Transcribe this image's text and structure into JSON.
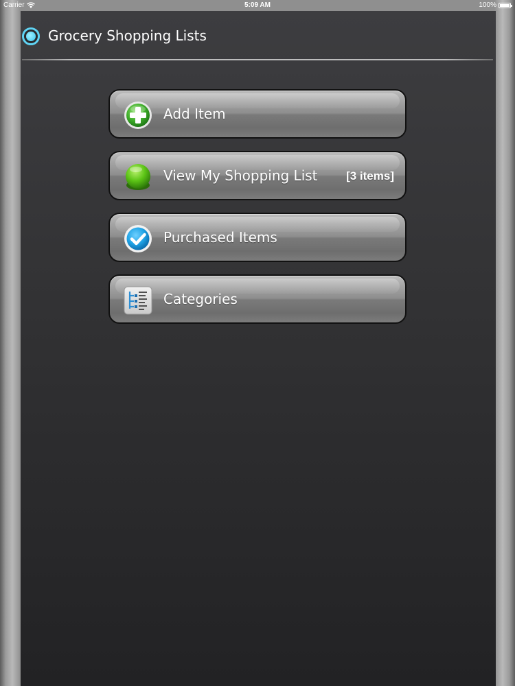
{
  "status_bar": {
    "carrier": "Carrier",
    "time": "5:09 AM",
    "battery": "100%"
  },
  "header": {
    "title": "Grocery Shopping Lists",
    "icon": "app-ring-icon"
  },
  "menu": {
    "items": [
      {
        "label": "Add Item",
        "icon": "add-plus-icon"
      },
      {
        "label": "View My Shopping List",
        "badge": "[3 items]",
        "icon": "green-ball-icon"
      },
      {
        "label": "Purchased Items",
        "icon": "checkmark-icon"
      },
      {
        "label": "Categories",
        "icon": "categories-tree-icon"
      }
    ]
  },
  "colors": {
    "accent": "#5fd3f3",
    "add_green": "#3fae2a",
    "check_blue": "#1fa3e6"
  }
}
